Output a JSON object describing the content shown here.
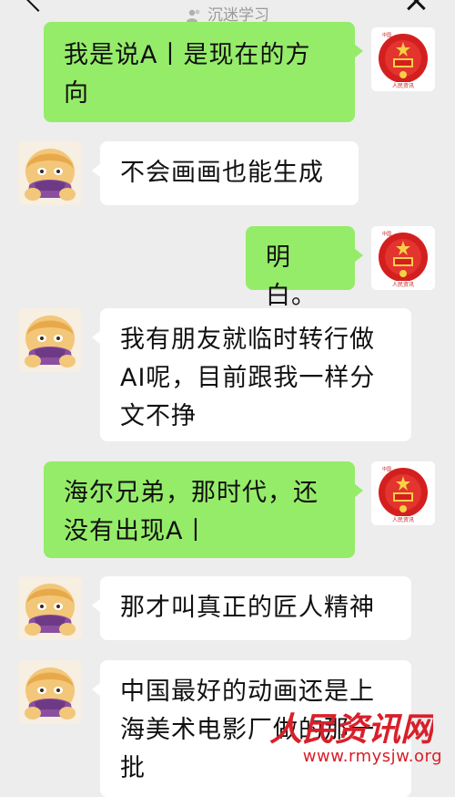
{
  "header": {
    "subtitle": "沉迷学习",
    "subtitle_icon": "user-group-icon"
  },
  "messages": [
    {
      "sender": "me",
      "text": "我是说A丨是现在的方向",
      "avatar": "national-emblem-avatar"
    },
    {
      "sender": "other",
      "text": "不会画画也能生成",
      "avatar": "cartoon-avatar"
    },
    {
      "sender": "me",
      "text": "明白。",
      "avatar": "national-emblem-avatar"
    },
    {
      "sender": "other",
      "text": "我有朋友就临时转行做AI呢，目前跟我一样分文不挣",
      "avatar": "cartoon-avatar"
    },
    {
      "sender": "me",
      "text": "海尔兄弟，那时代，还没有出现A丨",
      "avatar": "national-emblem-avatar"
    },
    {
      "sender": "other",
      "text": "那才叫真正的匠人精神",
      "avatar": "cartoon-avatar"
    },
    {
      "sender": "other",
      "text": "中国最好的动画还是上海美术电影厂做的那一批",
      "avatar": "cartoon-avatar"
    }
  ],
  "watermark": {
    "logo_text": "人民资讯网",
    "url": "www.rmysjw.org"
  },
  "colors": {
    "background": "#ededed",
    "my_bubble": "#95ec69",
    "other_bubble": "#ffffff",
    "watermark_red": "#d8202a"
  }
}
